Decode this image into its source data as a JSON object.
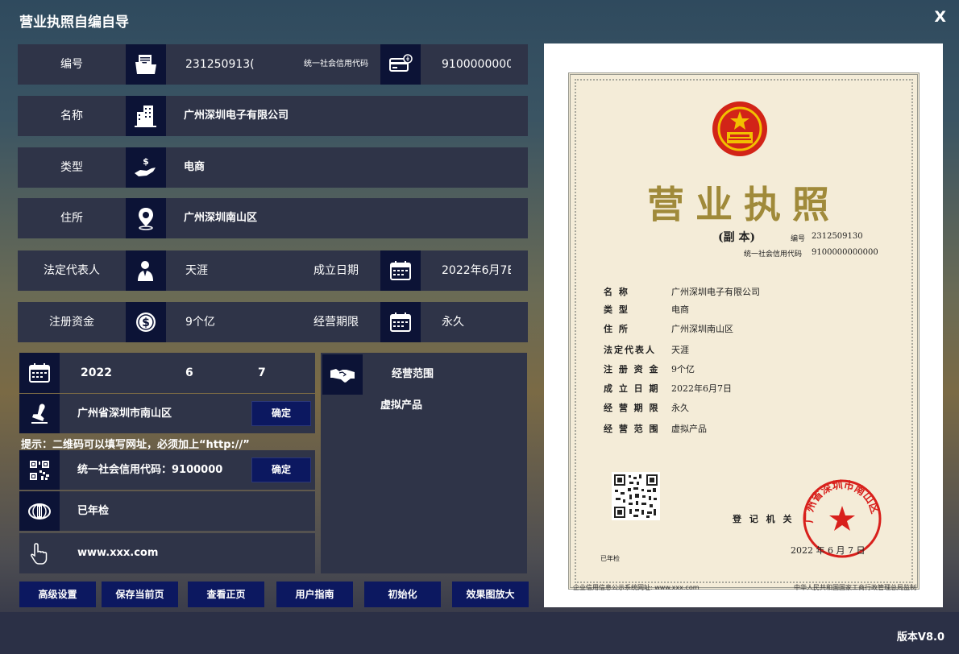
{
  "app": {
    "title": "营业执照自编自导",
    "close": "X",
    "version": "版本V8.0"
  },
  "fields": {
    "number": {
      "label": "编号",
      "value": "231250913("
    },
    "credit_code": {
      "label": "统一社会信用代码",
      "value": "9100000000"
    },
    "name": {
      "label": "名称",
      "value": "广州深圳电子有限公司"
    },
    "type": {
      "label": "类型",
      "value": "电商"
    },
    "address": {
      "label": "住所",
      "value": "广州深圳南山区"
    },
    "rep": {
      "label": "法定代表人",
      "value": "天涯"
    },
    "found_date": {
      "label": "成立日期",
      "value": "2022年6月7E"
    },
    "capital": {
      "label": "注册资金",
      "value": "9个亿"
    },
    "period": {
      "label": "经营期限",
      "value": "永久"
    }
  },
  "date_panel": {
    "year": "2022",
    "month": "6",
    "day": "7"
  },
  "seal_panel": {
    "text": "广州省深圳市南山区",
    "confirm": "确定"
  },
  "hint": "提示：二维码可以填写网址，必须加上“http://”",
  "qr_panel": {
    "text": "统一社会信用代码：9100000",
    "confirm": "确定"
  },
  "inspect_panel": {
    "text": "已年检"
  },
  "url_panel": {
    "text": "www.xxx.com"
  },
  "scope_panel": {
    "title": "经营范围",
    "value": "虚拟产品"
  },
  "buttons": [
    "高级设置",
    "保存当前页",
    "查看正页",
    "用户指南",
    "初始化",
    "效果图放大"
  ],
  "license": {
    "title": "营业执照",
    "fuben": "(副  本)",
    "number_label": "编号",
    "number": "2312509130",
    "credit_label": "统一社会信用代码",
    "credit": "9100000000000",
    "rows": [
      {
        "label": "名      称",
        "value": "广州深圳电子有限公司"
      },
      {
        "label": "类      型",
        "value": "电商"
      },
      {
        "label": "住      所",
        "value": "广州深圳南山区"
      },
      {
        "label": "法定代表人",
        "value": "天涯"
      },
      {
        "label": "注 册 资 金",
        "value": "9个亿"
      },
      {
        "label": "成 立 日 期",
        "value": "2022年6月7日"
      },
      {
        "label": "经 营 期 限",
        "value": "永久"
      },
      {
        "label": "经 营 范 围",
        "value": "虚拟产品"
      }
    ],
    "registrar": "登 记 机 关",
    "seal_text": "广州省深圳市南山区",
    "date": "2022 年   6 月  7 日",
    "inspected": "已年检",
    "footer_left": "企业信用信息公示系统网址: www.xxx.com",
    "footer_right": "中华人民共和国国家工商行政管理总局监制"
  }
}
